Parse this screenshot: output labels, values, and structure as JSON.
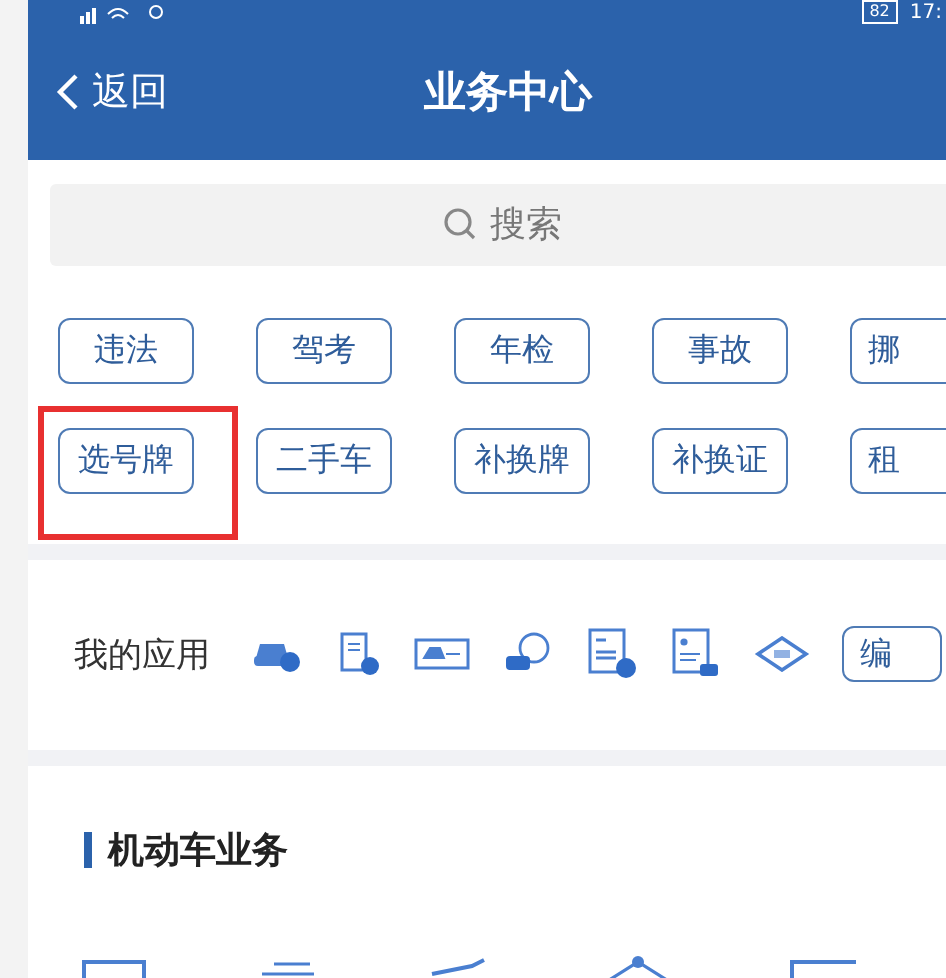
{
  "status_bar": {
    "battery": "82",
    "time": "17:"
  },
  "header": {
    "back": "返回",
    "title": "业务中心"
  },
  "search": {
    "placeholder": "搜索"
  },
  "tags": [
    {
      "label": "违法",
      "highlighted": false
    },
    {
      "label": "驾考",
      "highlighted": false
    },
    {
      "label": "年检",
      "highlighted": false
    },
    {
      "label": "事故",
      "highlighted": false
    },
    {
      "label": "挪",
      "highlighted": false
    },
    {
      "label": "选号牌",
      "highlighted": true
    },
    {
      "label": "二手车",
      "highlighted": false
    },
    {
      "label": "补换牌",
      "highlighted": false
    },
    {
      "label": "补换证",
      "highlighted": false
    },
    {
      "label": "租",
      "highlighted": false
    }
  ],
  "my_apps": {
    "label": "我的应用",
    "icons": [
      {
        "kind": "car"
      },
      {
        "kind": "scroll"
      },
      {
        "kind": "plate"
      },
      {
        "kind": "carbadge"
      },
      {
        "kind": "doc"
      },
      {
        "kind": "idcard"
      },
      {
        "kind": "diamond"
      }
    ],
    "edit": "编"
  },
  "section": {
    "title": "机动车业务"
  }
}
